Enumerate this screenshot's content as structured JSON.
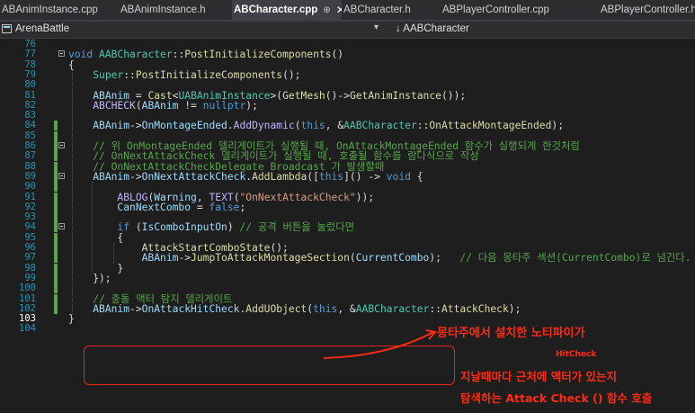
{
  "tabs": [
    {
      "label": "ABAnimInstance.cpp",
      "active": false
    },
    {
      "label": "ABAnimInstance.h",
      "active": false
    },
    {
      "label": "ABCharacter.cpp",
      "active": true,
      "pin": "⊕",
      "close": "✕"
    },
    {
      "label": "ABCharacter.h",
      "active": false
    },
    {
      "label": "ABPlayerController.cpp",
      "active": false
    },
    {
      "label": "ABPlayerController.h",
      "active": false
    }
  ],
  "navbar": {
    "project": "ArenaBattle",
    "dropdown_glyph": "▾",
    "scope": "↓ AABCharacter"
  },
  "lines": [
    {
      "n": "76",
      "html": ""
    },
    {
      "n": "77",
      "html": "<span class='kw'>void</span> <span class='ty'>AABCharacter</span>::<span class='fn'>PostInitializeComponents</span>()"
    },
    {
      "n": "78",
      "html": "{"
    },
    {
      "n": "79",
      "html": "    <span class='ty'>Super</span>::<span class='fn'>PostInitializeComponents</span>();"
    },
    {
      "n": "80",
      "html": ""
    },
    {
      "n": "81",
      "html": "    <span class='var'>ABAnim</span> = <span class='fn'>Cast</span>&lt;<span class='ty'>UABAnimInstance</span>&gt;(<span class='fn'>GetMesh</span>()-&gt;<span class='fn'>GetAnimInstance</span>());"
    },
    {
      "n": "82",
      "html": "    <span class='mac'>ABCHECK</span>(<span class='var'>ABAnim</span> != <span class='kw'>nullptr</span>);"
    },
    {
      "n": "83",
      "html": ""
    },
    {
      "n": "84",
      "html": "    <span class='var'>ABAnim</span>-&gt;<span class='var'>OnMontageEnded</span>.<span class='mac'>AddDynamic</span>(<span class='kw'>this</span>, &amp;<span class='ty'>AABCharacter</span>::<span class='fn'>OnAttackMontageEnded</span>);"
    },
    {
      "n": "85",
      "html": ""
    },
    {
      "n": "86",
      "html": "    <span class='cm'>// 위 OnMontageEnded 델리게이트가 실행될 때, OnAttackMontageEnded 함수가 실행되게 한것처럼</span>"
    },
    {
      "n": "87",
      "html": "    <span class='cm'>// OnNextAttackCheck 델리게이트가 실행될 때, 호출될 함수를 람다식으로 작성</span>"
    },
    {
      "n": "88",
      "html": "    <span class='cm'>// OnNextAttackCheckDelegate Broadcast 가 발생할때</span>"
    },
    {
      "n": "89",
      "html": "    <span class='var'>ABAnim</span>-&gt;<span class='var'>OnNextAttackCheck</span>.<span class='fn'>AddLambda</span>([<span class='kw'>this</span>]() -&gt; <span class='kw'>void</span> {"
    },
    {
      "n": "90",
      "html": ""
    },
    {
      "n": "91",
      "html": "        <span class='mac'>ABLOG</span>(<span class='var'>Warning</span>, <span class='mac'>TEXT</span>(<span class='str'>\"OnNextAttackCheck\"</span>));"
    },
    {
      "n": "92",
      "html": "        <span class='var'>CanNextCombo</span> = <span class='kw'>false</span>;"
    },
    {
      "n": "93",
      "html": ""
    },
    {
      "n": "94",
      "html": "        <span class='kw'>if</span> (<span class='var'>IsComboInputOn</span>) <span class='cm'>// 공격 버튼을 눌렀다면</span>"
    },
    {
      "n": "95",
      "html": "        {"
    },
    {
      "n": "96",
      "html": "            <span class='fn'>AttackStartComboState</span>();"
    },
    {
      "n": "97",
      "html": "            <span class='var'>ABAnim</span>-&gt;<span class='fn'>JumpToAttackMontageSection</span>(<span class='var'>CurrentCombo</span>);   <span class='cm'>// 다음 몽타주 섹션(CurrentCombo)로 넘긴다.</span>"
    },
    {
      "n": "98",
      "html": "        }"
    },
    {
      "n": "99",
      "html": "    });"
    },
    {
      "n": "100",
      "html": ""
    },
    {
      "n": "101",
      "html": "    <span class='cm'>// 충돌 액터 탐지 델리게이트</span>"
    },
    {
      "n": "102",
      "html": "    <span class='var'>ABAnim</span>-&gt;<span class='var'>OnAttackHitCheck</span>.<span class='fn'>AddUObject</span>(<span class='kw'>this</span>, &amp;<span class='ty'>AABCharacter</span>::<span class='fn'>AttackCheck</span>);"
    },
    {
      "n": "103",
      "html": "}"
    },
    {
      "n": "104",
      "html": ""
    }
  ],
  "annotations": {
    "arrow_label": "몽타주에서 설치한 노티파이가",
    "hitcheck_label": "HitCheck",
    "line1": "지날때마다 근처에 액터가 있는지",
    "line2": "탐색하는 Attack Check () 함수 호출",
    "ink_color": "#ff2a12"
  }
}
